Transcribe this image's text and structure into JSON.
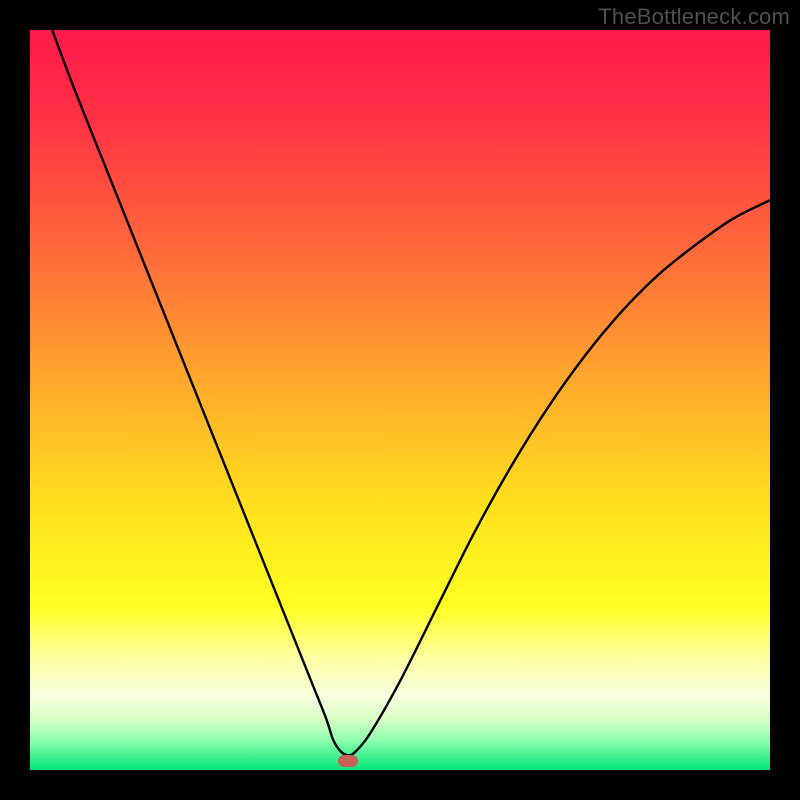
{
  "watermark": "TheBottleneck.com",
  "chart_data": {
    "type": "line",
    "title": "",
    "xlabel": "",
    "ylabel": "",
    "xlim": [
      0,
      100
    ],
    "ylim": [
      0,
      100
    ],
    "series": [
      {
        "name": "bottleneck-curve",
        "x": [
          3,
          6,
          10,
          14,
          18,
          22,
          26,
          30,
          34,
          38,
          40,
          41,
          42,
          43,
          44,
          46,
          50,
          55,
          60,
          65,
          70,
          75,
          80,
          85,
          90,
          95,
          100
        ],
        "y": [
          100,
          92,
          82,
          72,
          62,
          52,
          42,
          32,
          22,
          12,
          7,
          4,
          2.5,
          2,
          2.5,
          5,
          12,
          22,
          32,
          41,
          49,
          56,
          62,
          67,
          71,
          74.5,
          77
        ]
      }
    ],
    "marker": {
      "x": 43,
      "y": 1.2
    },
    "gradient_stops": [
      {
        "offset": 0,
        "color": "#ff1a4b"
      },
      {
        "offset": 0.12,
        "color": "#ff3144"
      },
      {
        "offset": 0.3,
        "color": "#ff6a3a"
      },
      {
        "offset": 0.5,
        "color": "#ffb12a"
      },
      {
        "offset": 0.65,
        "color": "#ffe21e"
      },
      {
        "offset": 0.78,
        "color": "#ffff22"
      },
      {
        "offset": 0.85,
        "color": "#fdffa4"
      },
      {
        "offset": 0.9,
        "color": "#f9ffe0"
      },
      {
        "offset": 0.93,
        "color": "#d9ffc4"
      },
      {
        "offset": 0.96,
        "color": "#8effac"
      },
      {
        "offset": 1.0,
        "color": "#00e57a"
      }
    ]
  }
}
